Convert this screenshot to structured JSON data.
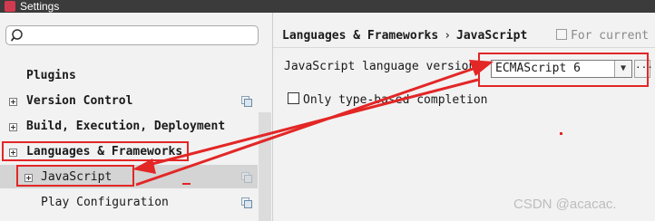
{
  "window": {
    "title": "Settings"
  },
  "search": {
    "value": "",
    "placeholder": ""
  },
  "tree": {
    "items": [
      {
        "label": "Plugins"
      },
      {
        "label": "Version Control"
      },
      {
        "label": "Build, Execution, Deployment"
      },
      {
        "label": "Languages & Frameworks"
      },
      {
        "label": "JavaScript"
      },
      {
        "label": "Play Configuration"
      }
    ]
  },
  "breadcrumb": {
    "parent": "Languages & Frameworks",
    "separator": "›",
    "current": "JavaScript"
  },
  "scope": {
    "label": "For current"
  },
  "settings": {
    "language_version_label": "JavaScript language version",
    "language_version_value": "ECMAScript 6",
    "more_button": "···",
    "only_type_based_label": "Only type-based completion"
  },
  "watermark": "CSDN @acacac.",
  "colors": {
    "annotation": "#e32626",
    "selection": "#d4d4d4",
    "titlebar": "#3b3b3b"
  },
  "icons": {
    "app": "intellij-icon",
    "search": "search-icon",
    "expand": "plus-box-icon",
    "project": "project-scope-icon",
    "dropdown": "chevron-down-icon"
  }
}
